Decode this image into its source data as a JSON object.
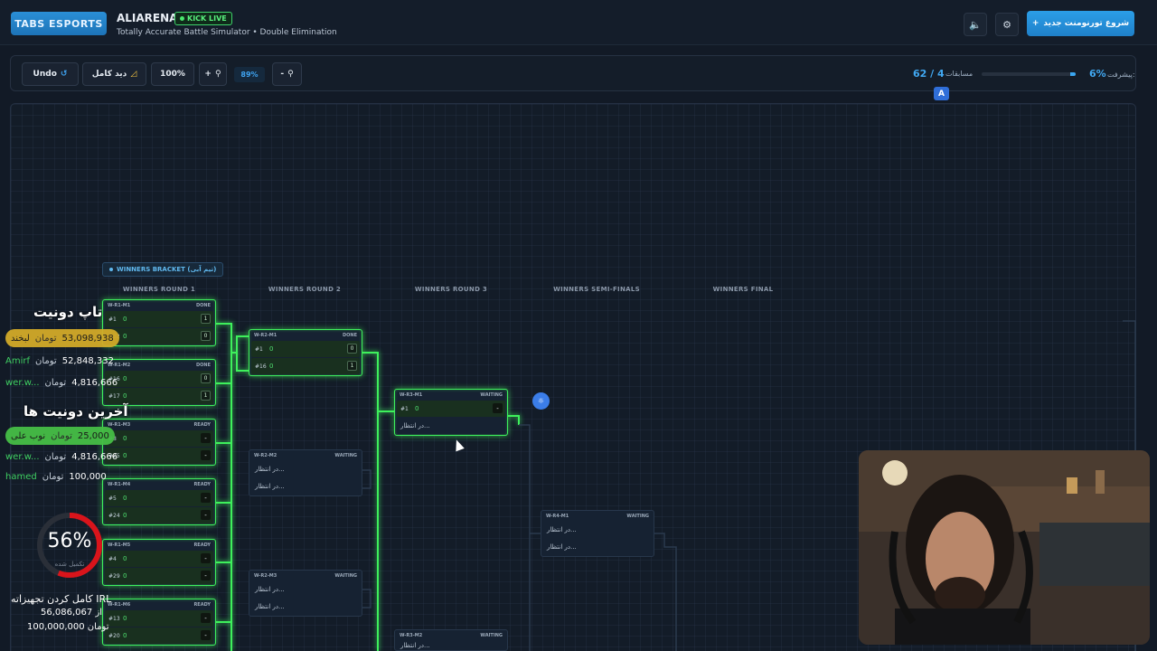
{
  "header": {
    "logo": "TABS ESPORTS",
    "brand": "ALIARENA",
    "live_badge": "KICK LIVE",
    "subtitle": "Totally Accurate Battle Simulator • Double Elimination",
    "new_tournament": "شروع تورنومنت جدید",
    "sound_icon": "speaker-icon",
    "settings_icon": "gear-icon"
  },
  "toolbar": {
    "undo": "Undo",
    "full_view": "دید کامل",
    "zoom_reset": "100%",
    "zoom_in": "+",
    "zoom_value": "89%",
    "zoom_out": "-",
    "progress_label": "پیشرفت:",
    "progress_pct": "6%",
    "progress_fraction": 0.06,
    "match_label": "مسابقات",
    "match_count": "62 / 4",
    "translate": "A"
  },
  "bracket": {
    "badge": "WINNERS BRACKET (تیم آبی)",
    "rounds": [
      "WINNERS ROUND 1",
      "WINNERS ROUND 2",
      "WINNERS ROUND 3",
      "WINNERS SEMI-FINALS",
      "WINNERS FINAL"
    ],
    "matches": [
      {
        "id": "W-R1-M1",
        "status": "DONE",
        "p1": "#1",
        "s1": "1",
        "p2": "#32",
        "s2": "0"
      },
      {
        "id": "W-R1-M2",
        "status": "DONE",
        "p1": "#16",
        "s1": "0",
        "p2": "#17",
        "s2": "1"
      },
      {
        "id": "W-R1-M3",
        "status": "READY",
        "p1": "#8",
        "s1": "0",
        "p2": "#25",
        "s2": "0"
      },
      {
        "id": "W-R1-M4",
        "status": "READY",
        "p1": "#5",
        "s1": "0",
        "p2": "#24",
        "s2": "0"
      },
      {
        "id": "W-R1-M5",
        "status": "READY",
        "p1": "#4",
        "s1": "0",
        "p2": "#29",
        "s2": "0"
      },
      {
        "id": "W-R1-M6",
        "status": "READY",
        "p1": "#13",
        "s1": "0",
        "p2": "#20",
        "s2": "0"
      },
      {
        "id": "W-R2-M1",
        "status": "DONE",
        "p1": "#1",
        "s1": "0",
        "p2": "#16",
        "s2": "1"
      },
      {
        "id": "W-R2-M2",
        "status": "WAITING",
        "p1": "در انتظار...",
        "p2": "در انتظار..."
      },
      {
        "id": "W-R2-M3",
        "status": "WAITING",
        "p1": "در انتظار...",
        "p2": "در انتظار..."
      },
      {
        "id": "W-R3-M1",
        "status": "WAITING",
        "p1": "#1",
        "s1": "0",
        "p2": "در انتظار..."
      },
      {
        "id": "W-R3-M2",
        "status": "WAITING",
        "p1": "در انتظار..."
      },
      {
        "id": "W-R4-M1",
        "status": "WAITING",
        "p1": "در انتظار...",
        "p2": "در انتظار..."
      }
    ]
  },
  "overlay": {
    "top_title": "تاپ دونیت",
    "top_donors": [
      {
        "name": "لبخند",
        "currency": "تومان",
        "amount": "53,098,938"
      },
      {
        "name": "Amirf",
        "currency": "تومان",
        "amount": "52,848,332"
      },
      {
        "name": "wer.w...",
        "currency": "تومان",
        "amount": "4,816,666"
      }
    ],
    "recent_title": "آخرین دونیت ها",
    "recent_donors": [
      {
        "name": "نوب علی",
        "currency": "تومان",
        "amount": "25,000"
      },
      {
        "name": "wer.w...",
        "currency": "تومان",
        "amount": "4,816,666"
      },
      {
        "name": "hamed",
        "currency": "تومان",
        "amount": "100,000"
      }
    ],
    "goal_pct": "56%",
    "goal_fraction": 0.56,
    "goal_sub": "تکمیل شده",
    "goal_line1": "کامل کردن تجهیزاته IRL",
    "goal_line2": "56,086,067 از",
    "goal_line3": "100,000,000 تومان"
  },
  "colors": {
    "accent": "#2b9ee8",
    "done_glow": "#3ef05c",
    "bg": "#131c28"
  }
}
